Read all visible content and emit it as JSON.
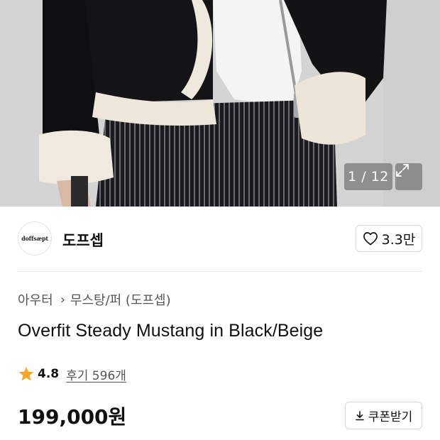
{
  "gallery": {
    "counter": "1 / 12"
  },
  "brand": {
    "logo_text": "doffsæpt",
    "name": "도프셉",
    "likes": "3.3만"
  },
  "breadcrumb": {
    "category": "아우터",
    "subcategory": "무스탕/퍼 (도프셉)"
  },
  "product": {
    "title": "Overfit Steady Mustang in Black/Beige",
    "rating": "4.8",
    "reviews": "후기 596개",
    "price": "199,000원"
  },
  "actions": {
    "coupon_label": "쿠폰받기"
  },
  "colors": {
    "star": "#f5a623",
    "text": "#111111",
    "muted": "#555555",
    "border": "#d8d8d8"
  },
  "icons": {
    "like": "heart-outline-icon",
    "rating": "star-icon",
    "coupon": "download-icon",
    "expand": "expand-icon"
  }
}
